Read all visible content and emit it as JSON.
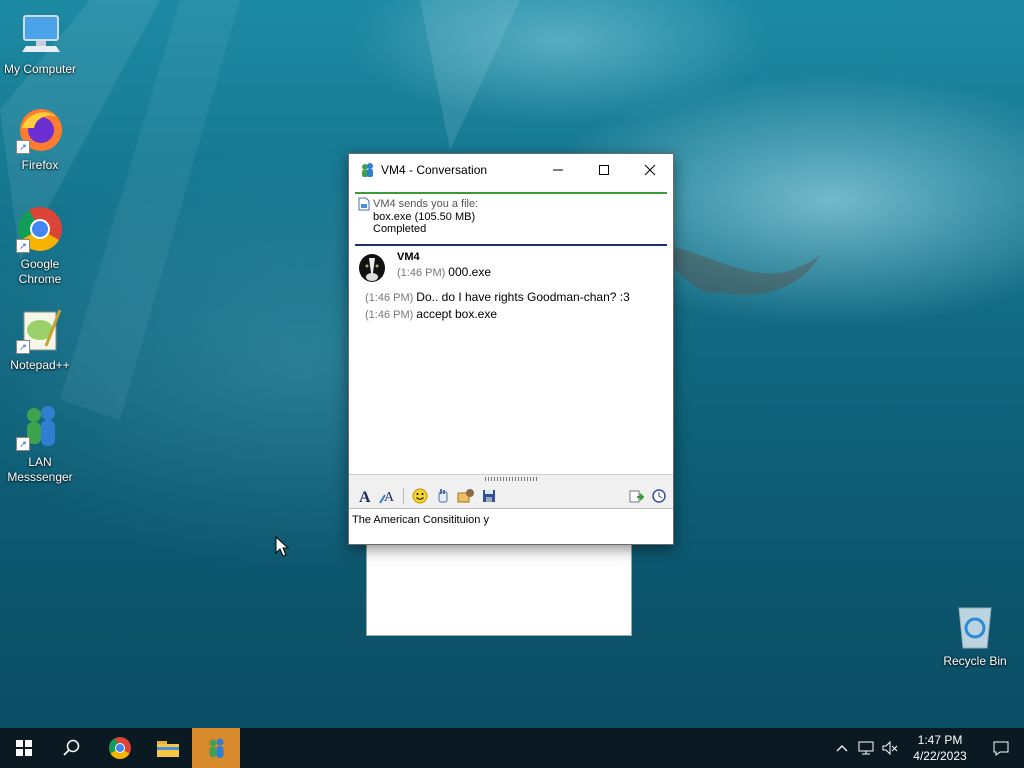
{
  "desktop": {
    "icons": [
      {
        "label": "My Computer",
        "icon": "computer-icon"
      },
      {
        "label": "Firefox",
        "icon": "firefox-icon"
      },
      {
        "label": "Google Chrome",
        "icon": "chrome-icon"
      },
      {
        "label": "Notepad++",
        "icon": "notepad-plus-plus-icon"
      },
      {
        "label": "LAN Messsenger",
        "icon": "lan-messenger-icon"
      },
      {
        "label": "Recycle Bin",
        "icon": "recycle-bin-icon"
      }
    ]
  },
  "window": {
    "title": "VM4 - Conversation",
    "file_transfer": {
      "intro": "VM4 sends you a file:",
      "file": "box.exe (105.50 MB)",
      "status": "Completed"
    },
    "sender": "VM4",
    "messages": [
      {
        "time": "(1:46 PM)",
        "text": "000.exe"
      },
      {
        "time": "(1:46 PM)",
        "text": "Do.. do I have rights Goodman-chan? :3"
      },
      {
        "time": "(1:46 PM)",
        "text": "accept box.exe"
      }
    ],
    "input_value": "The American Consitituion y"
  },
  "taskbar": {
    "time": "1:47 PM",
    "date": "4/22/2023"
  },
  "colors": {
    "file_border": "#3a9a3a",
    "separator": "#1e2d7a",
    "taskbar": "#0b1a22",
    "active_task": "#d88a2c"
  }
}
